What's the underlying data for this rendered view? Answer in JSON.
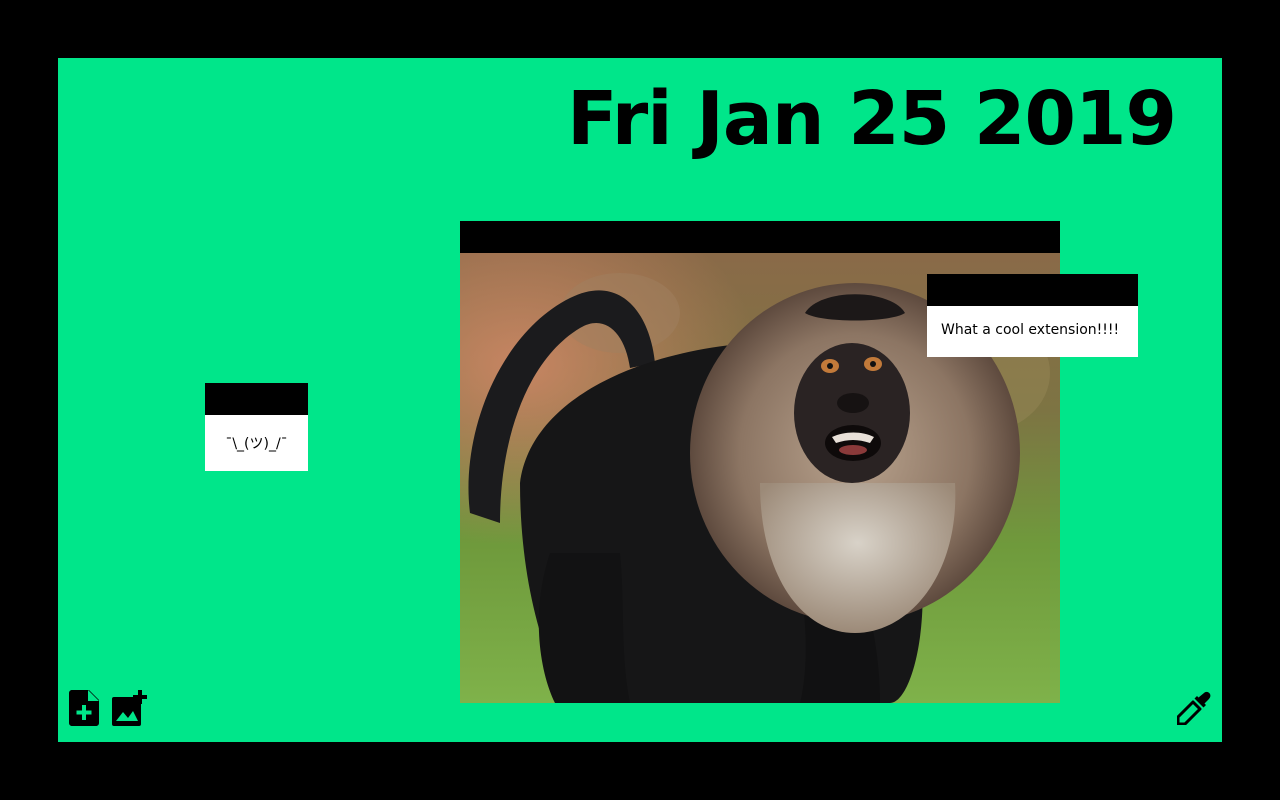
{
  "board": {
    "background_color": "#00e68a",
    "date": "Fri Jan 25 2019"
  },
  "notes": [
    {
      "text": "¯\\_(ツ)_/¯"
    },
    {
      "text": "What a cool extension!!!!"
    }
  ],
  "image_card": {
    "subject": "lion-tailed macaque photo"
  },
  "toolbar": {
    "add_note_icon": "add-note-icon",
    "add_image_icon": "add-image-icon",
    "color_picker_icon": "eyedropper-icon"
  }
}
